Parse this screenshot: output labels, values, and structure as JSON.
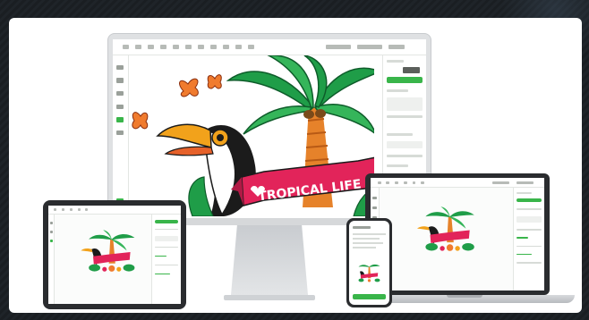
{
  "artwork": {
    "banner_text": "TROPICAL LIFE"
  },
  "colors": {
    "brand_green": "#39b54a",
    "banner_red": "#e2245a",
    "palm_green": "#1f9d48",
    "trunk_orange": "#e6822a",
    "toucan_beak": "#f2a21b",
    "butterfly": "#f07b2e",
    "background": "#1d2126",
    "card": "#ffffff"
  },
  "devices": [
    "imac",
    "laptop",
    "tablet",
    "phone"
  ],
  "icons": [
    "butterfly-icon",
    "palm-tree-icon",
    "toucan-icon",
    "heart-icon"
  ]
}
